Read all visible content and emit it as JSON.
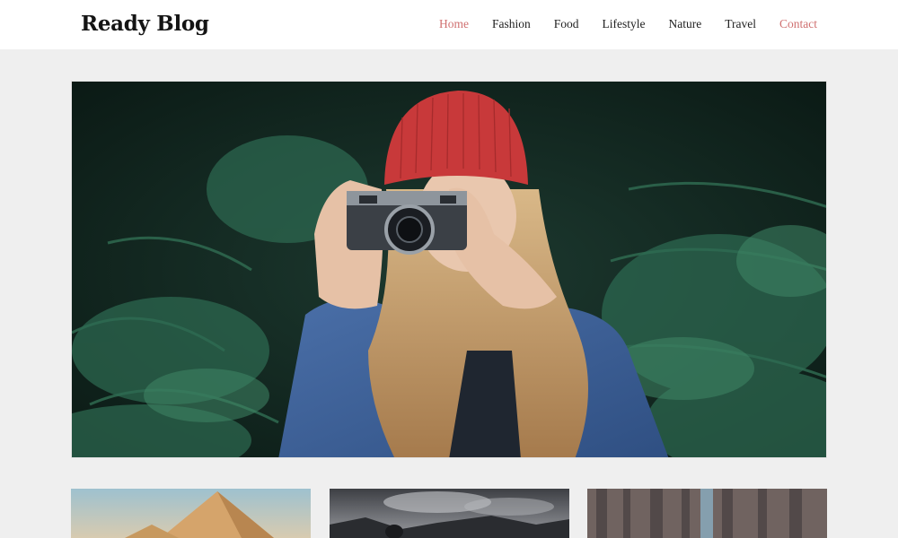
{
  "site": {
    "title": "Ready Blog"
  },
  "nav": {
    "items": [
      {
        "label": "Home",
        "state": "active"
      },
      {
        "label": "Fashion",
        "state": "normal"
      },
      {
        "label": "Food",
        "state": "normal"
      },
      {
        "label": "Lifestyle",
        "state": "normal"
      },
      {
        "label": "Nature",
        "state": "normal"
      },
      {
        "label": "Travel",
        "state": "normal"
      },
      {
        "label": "Contact",
        "state": "highlight"
      }
    ]
  },
  "colors": {
    "accent": "#d07070",
    "background": "#efefef",
    "header": "#ffffff"
  }
}
